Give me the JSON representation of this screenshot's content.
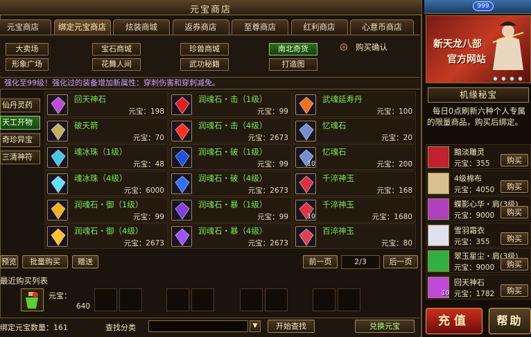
{
  "window": {
    "title": "元宝商店",
    "close": "✕"
  },
  "top_right": {
    "level": "999"
  },
  "tabs": [
    {
      "label": "元宝商店",
      "active": false
    },
    {
      "label": "绑定元宝商店",
      "active": true
    },
    {
      "label": "炫装商城",
      "active": false
    },
    {
      "label": "返券商店",
      "active": false
    },
    {
      "label": "至尊商店",
      "active": false
    },
    {
      "label": "红利商店",
      "active": false
    },
    {
      "label": "心意币商店",
      "active": false
    }
  ],
  "categories": [
    {
      "label": "大卖场",
      "active": false
    },
    {
      "label": "宝石商城",
      "active": false
    },
    {
      "label": "珍兽商城",
      "active": false
    },
    {
      "label": "南北奇货",
      "active": true
    },
    {
      "label": "形象广场",
      "active": false
    },
    {
      "label": "花舞人间",
      "active": false
    },
    {
      "label": "武功秘籍",
      "active": false
    },
    {
      "label": "打造图",
      "active": false
    }
  ],
  "purchase_confirm": {
    "label": "购买确认"
  },
  "notice": "强化至99级！强化过的装备增加新属性：穿刺伤害和穿刺减免。",
  "side_categories": [
    {
      "label": "仙丹灵药",
      "active": false
    },
    {
      "label": "天工开物",
      "active": true
    },
    {
      "label": "奇珍异宝",
      "active": false
    },
    {
      "label": "三清神符",
      "active": false
    }
  ],
  "price_label": "元宝：",
  "items": [
    {
      "name": "回天神石",
      "price": "198",
      "color": "green",
      "icon": "magic-stone-icon",
      "gem": "#c04ad8",
      "qty": ""
    },
    {
      "name": "润魂石・击（1级）",
      "price": "99",
      "color": "green",
      "icon": "red-gem-icon",
      "gem": "#e02020",
      "qty": ""
    },
    {
      "name": "武魂延寿丹",
      "price": "100",
      "color": "green",
      "icon": "fire-pill-icon",
      "gem": "#f07020",
      "qty": ""
    },
    {
      "name": "破天箭",
      "price": "70",
      "color": "green",
      "icon": "arrow-icon",
      "gem": "#c0b060",
      "qty": ""
    },
    {
      "name": "润魂石・击（4级）",
      "price": "2673",
      "color": "green",
      "icon": "red-gem-icon",
      "gem": "#ff3020",
      "qty": ""
    },
    {
      "name": "忆魂石",
      "price": "20",
      "color": "green",
      "icon": "soul-stone-icon",
      "gem": "#7090d0",
      "qty": ""
    },
    {
      "name": "魂冰珠（1级）",
      "price": "48",
      "color": "green",
      "icon": "ice-orb-icon",
      "gem": "#40c8e8",
      "qty": ""
    },
    {
      "name": "润魂石・破（1级）",
      "price": "99",
      "color": "green",
      "icon": "blue-gem-icon",
      "gem": "#2050e0",
      "qty": ""
    },
    {
      "name": "忆魂石",
      "price": "200",
      "color": "green",
      "icon": "soul-stone-icon",
      "gem": "#7090d0",
      "qty": "10"
    },
    {
      "name": "魂冰珠（4级）",
      "price": "6000",
      "color": "green",
      "icon": "ice-orb-icon",
      "gem": "#60e0ff",
      "qty": ""
    },
    {
      "name": "润魂石・破（4级）",
      "price": "2673",
      "color": "green",
      "icon": "blue-gem-icon",
      "gem": "#3070ff",
      "qty": ""
    },
    {
      "name": "千淬神玉",
      "price": "168",
      "color": "green",
      "icon": "jade-icon",
      "gem": "#e03040",
      "qty": ""
    },
    {
      "name": "润魂石・御（1级）",
      "price": "99",
      "color": "green",
      "icon": "yellow-gem-icon",
      "gem": "#f0b020",
      "qty": ""
    },
    {
      "name": "润魂石・暴（1级）",
      "price": "99",
      "color": "green",
      "icon": "purple-gem-icon",
      "gem": "#8040e0",
      "qty": ""
    },
    {
      "name": "千淬神玉",
      "price": "1680",
      "color": "green",
      "icon": "jade-icon",
      "gem": "#e03040",
      "qty": "10"
    },
    {
      "name": "润魂石・御（4级）",
      "price": "2673",
      "color": "green",
      "icon": "yellow-gem-icon",
      "gem": "#ffc030",
      "qty": ""
    },
    {
      "name": "润魂石・暴（4级）",
      "price": "2673",
      "color": "green",
      "icon": "purple-gem-icon",
      "gem": "#a050ff",
      "qty": ""
    },
    {
      "name": "百淬神玉",
      "price": "80",
      "color": "green",
      "icon": "jade-icon",
      "gem": "#e04050",
      "qty": ""
    }
  ],
  "actions": {
    "preview": "预览",
    "bulk_buy": "批量购买",
    "gift": "赠送"
  },
  "pagination": {
    "prev": "前一页",
    "current": "2/3",
    "next": "后一页"
  },
  "recent": {
    "title": "最近购买列表",
    "price_label": "元宝：",
    "price": "640"
  },
  "footer": {
    "balance_label": "绑定元宝数量：",
    "balance": "161",
    "search_label": "查找分类",
    "search_value": "",
    "dropdown": "▼",
    "search_button": "开始查找",
    "exchange_button": "兑换元宝"
  },
  "banner": {
    "line1": "新天龙八部",
    "line2": "官方网站"
  },
  "destiny": {
    "title": "机缘秘宝",
    "description": "每日0点刷新六种个人专属的限量商品，购买后绑定。",
    "buy_label": "购买",
    "items": [
      {
        "name": "黯淡雕灵",
        "price": "355",
        "icon": "spirit-icon",
        "qty": ""
      },
      {
        "name": "4级棉布",
        "price": "4050",
        "icon": "cloth-icon",
        "qty": ""
      },
      {
        "name": "蝶影心华・肩(3级)",
        "price": "9000",
        "icon": "butterfly-icon",
        "qty": ""
      },
      {
        "name": "雪羽霜衣",
        "price": "355",
        "icon": "robe-icon",
        "qty": ""
      },
      {
        "name": "翠玉星尘・肩(3级)",
        "price": "9000",
        "icon": "green-star-icon",
        "qty": ""
      },
      {
        "name": "回天神石",
        "price": "1782",
        "icon": "magic-stone-icon",
        "qty": "10"
      }
    ]
  },
  "recharge": "充值",
  "help": "帮助",
  "colors": {
    "accent": "#78e858",
    "gold": "#f0e4c0",
    "notice": "#c8a0ff",
    "border": "#8a7448"
  }
}
